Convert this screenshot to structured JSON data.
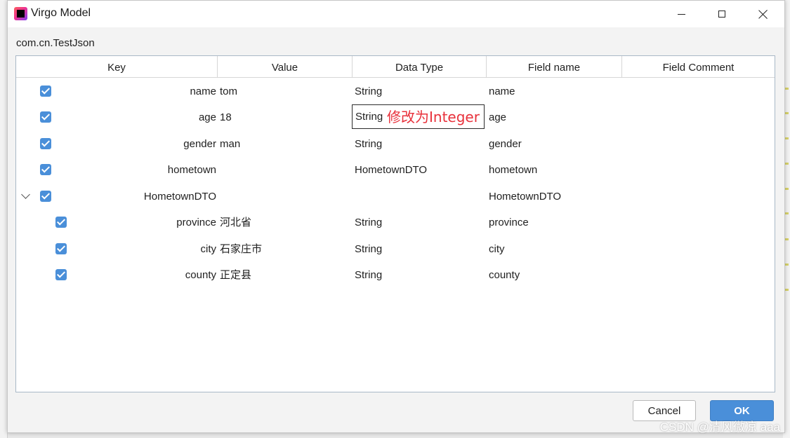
{
  "window": {
    "title": "Virgo Model",
    "app_icon": "intellij-icon"
  },
  "class_name": "com.cn.TestJson",
  "table": {
    "columns": [
      "Key",
      "Value",
      "Data Type",
      "Field name",
      "Field Comment"
    ],
    "rows": [
      {
        "key": "name",
        "value": "tom",
        "type": "String",
        "field": "name",
        "comment": "",
        "checked": true
      },
      {
        "key": "age",
        "value": "18",
        "type": "String",
        "field": "age",
        "comment": "",
        "checked": true
      },
      {
        "key": "gender",
        "value": "man",
        "type": "String",
        "field": "gender",
        "comment": "",
        "checked": true
      },
      {
        "key": "hometown",
        "value": "",
        "type": "HometownDTO",
        "field": "hometown",
        "comment": "",
        "checked": true
      },
      {
        "key": "HometownDTO",
        "value": "",
        "type": "",
        "field": "HometownDTO",
        "comment": "",
        "checked": true,
        "expanded": true
      },
      {
        "key": "province",
        "value": "河北省",
        "type": "String",
        "field": "province",
        "comment": "",
        "checked": true
      },
      {
        "key": "city",
        "value": "石家庄市",
        "type": "String",
        "field": "city",
        "comment": "",
        "checked": true
      },
      {
        "key": "county",
        "value": "正定县",
        "type": "String",
        "field": "county",
        "comment": "",
        "checked": true
      }
    ],
    "editing": {
      "row": 1,
      "text": "String",
      "annotation": "修改为Integer",
      "annotation_color": "#e8313b"
    }
  },
  "buttons": {
    "cancel": "Cancel",
    "ok": "OK"
  },
  "watermark": "CSDN @清风微凉 aaa",
  "colors": {
    "accent": "#4a8fd9",
    "annotation": "#e8313b"
  }
}
